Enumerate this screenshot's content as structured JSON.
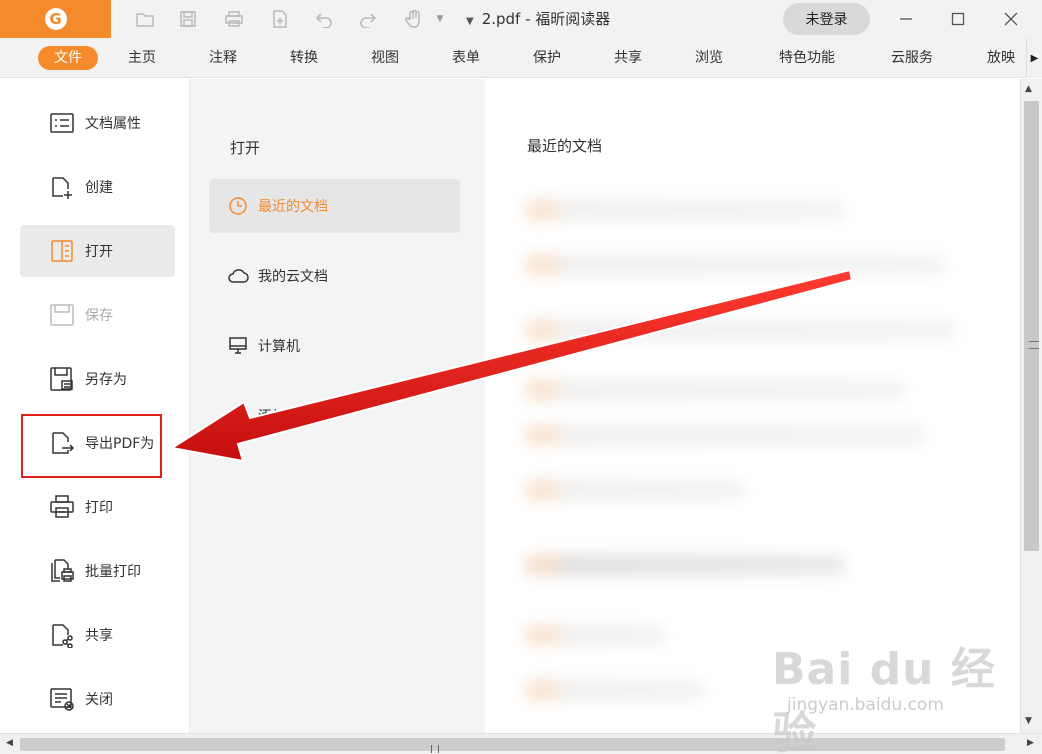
{
  "titlebar": {
    "document_title": "2.pdf - 福昕阅读器",
    "login_label": "未登录",
    "quick_access_icons": [
      "open-folder-icon",
      "save-icon",
      "print-icon",
      "new-file-icon",
      "undo-icon",
      "redo-icon",
      "hand-tool-icon"
    ],
    "window_controls": [
      "minimize-icon",
      "maximize-icon",
      "close-icon"
    ]
  },
  "menu": {
    "items": [
      "文件",
      "主页",
      "注释",
      "转换",
      "视图",
      "表单",
      "保护",
      "共享",
      "浏览",
      "特色功能",
      "云服务",
      "放映"
    ],
    "active": "文件"
  },
  "left_panel": {
    "items": [
      {
        "label": "文档属性",
        "icon": "properties-icon",
        "state": "normal"
      },
      {
        "label": "创建",
        "icon": "create-icon",
        "state": "normal"
      },
      {
        "label": "打开",
        "icon": "open-book-icon",
        "state": "selected"
      },
      {
        "label": "保存",
        "icon": "save-icon",
        "state": "disabled"
      },
      {
        "label": "另存为",
        "icon": "save-as-icon",
        "state": "normal"
      },
      {
        "label": "导出PDF为",
        "icon": "export-icon",
        "state": "normal"
      },
      {
        "label": "打印",
        "icon": "printer-icon",
        "state": "normal"
      },
      {
        "label": "批量打印",
        "icon": "batch-print-icon",
        "state": "normal"
      },
      {
        "label": "共享",
        "icon": "share-icon",
        "state": "normal"
      },
      {
        "label": "关闭",
        "icon": "close-doc-icon",
        "state": "normal"
      }
    ]
  },
  "middle_panel": {
    "heading": "打开",
    "items": [
      {
        "label": "最近的文档",
        "icon": "clock-icon",
        "state": "selected"
      },
      {
        "label": "我的云文档",
        "icon": "cloud-icon",
        "state": "normal"
      },
      {
        "label": "计算机",
        "icon": "computer-icon",
        "state": "normal"
      },
      {
        "label": "添加位置",
        "icon": "add-location-icon",
        "state": "normal"
      }
    ]
  },
  "right_panel": {
    "heading": "最近的文档"
  },
  "annotation": {
    "highlight_color": "#e0201b",
    "arrow_color": "#e0201b",
    "highlighted_item": "导出PDF为"
  },
  "watermark": {
    "text": "Bai du 经验",
    "url": "jingyan.baidu.com"
  },
  "colors": {
    "accent": "#f58a2c",
    "menubar_bg": "#f2f2f2",
    "middle_bg": "#f4f4f4"
  }
}
